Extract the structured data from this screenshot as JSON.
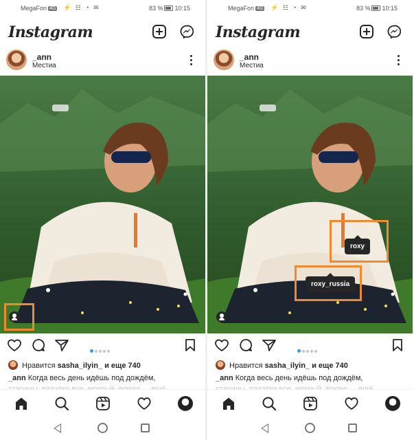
{
  "screens": [
    {
      "status": {
        "carrier": "MegaFon",
        "carrier_tag": "4G",
        "icons": "⚡ ☷ ◔ ✉",
        "battery_pct": "83 %",
        "time": "10:15"
      },
      "app_title": "Instagram",
      "post": {
        "username": "_ann",
        "location": "Местиа",
        "likes_prefix": "Нравится",
        "likes_user": "sasha_ilyin_",
        "likes_suffix": "и еще 740",
        "caption_user": "_ann",
        "caption_text": "Когда весь день идёшь под дождём,",
        "caption_more": "старины, палатки все, мокрый, вокруг ... ещё",
        "carousel_pages": 5,
        "carousel_active": 1
      }
    },
    {
      "status": {
        "carrier": "MegaFon",
        "carrier_tag": "4G",
        "icons": "⚡ ☷ ◔ ✉",
        "battery_pct": "83 %",
        "time": "10:15"
      },
      "app_title": "Instagram",
      "post": {
        "username": "_ann",
        "location": "Местиа",
        "likes_prefix": "Нравится",
        "likes_user": "sasha_ilyin_",
        "likes_suffix": "и еще 740",
        "caption_user": "_ann",
        "caption_text": "Когда весь день идёшь под дождём,",
        "caption_more": "старины, палатки все, мокрый, вокруг ... ещё",
        "carousel_pages": 5,
        "carousel_active": 1
      },
      "tags": [
        {
          "label": "roxy"
        },
        {
          "label": "roxy_russia"
        }
      ]
    }
  ],
  "colors": {
    "highlight": "#f08a2c",
    "accent": "#3897f0",
    "text": "#262626"
  },
  "icons": [
    "new-post-icon",
    "messenger-icon",
    "more-icon",
    "heart-icon",
    "comment-icon",
    "share-icon",
    "bookmark-icon",
    "home-icon",
    "search-icon",
    "reels-icon",
    "activity-icon",
    "person-tag-icon"
  ]
}
